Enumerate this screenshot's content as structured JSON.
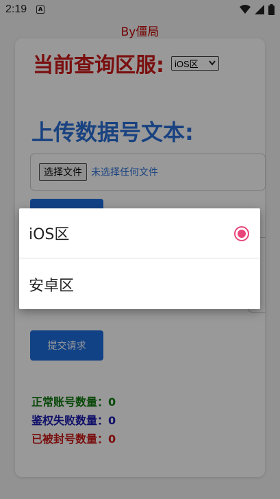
{
  "status_bar": {
    "time": "2:19",
    "notif_icon": "A"
  },
  "page": {
    "byline": "By僵局",
    "query_label": "当前查询区服:",
    "region_select_value": "iOS区",
    "upload_title": "上传数据号文本:",
    "file_button": "选择文件",
    "file_status": "未选择任何文件",
    "submit_1": "提交请求",
    "submit_2": "提交请求",
    "stats": {
      "normal": "正常账号数量：0",
      "auth_fail": "鉴权失败数量：0",
      "banned": "已被封号数量：0"
    }
  },
  "dialog": {
    "options": [
      {
        "label": "iOS区",
        "selected": true
      },
      {
        "label": "安卓区",
        "selected": false
      }
    ]
  },
  "colors": {
    "accent": "#e8457a",
    "blue": "#2b6fd6",
    "red": "#cc1a1a",
    "green": "#117a11"
  }
}
